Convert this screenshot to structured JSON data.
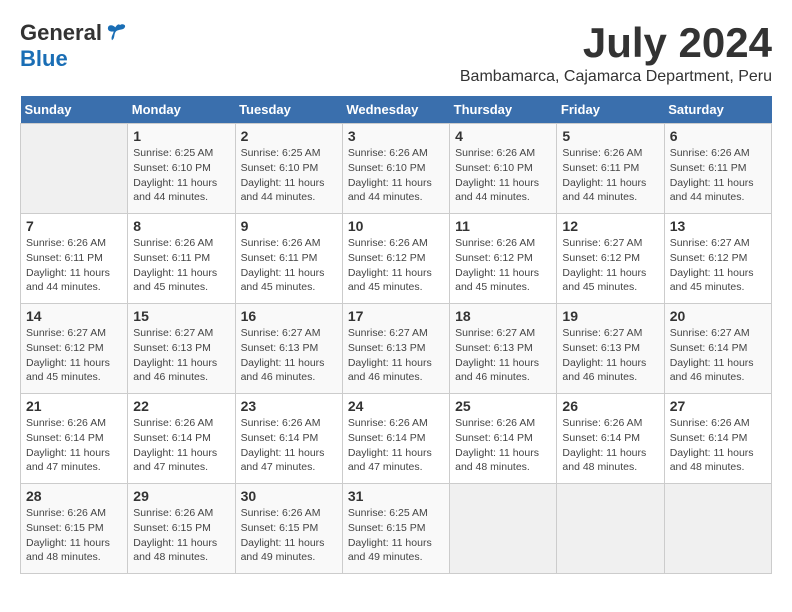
{
  "logo": {
    "general": "General",
    "blue": "Blue"
  },
  "title": {
    "month": "July 2024",
    "location": "Bambamarca, Cajamarca Department, Peru"
  },
  "calendar": {
    "headers": [
      "Sunday",
      "Monday",
      "Tuesday",
      "Wednesday",
      "Thursday",
      "Friday",
      "Saturday"
    ],
    "weeks": [
      [
        {
          "day": "",
          "info": ""
        },
        {
          "day": "1",
          "info": "Sunrise: 6:25 AM\nSunset: 6:10 PM\nDaylight: 11 hours\nand 44 minutes."
        },
        {
          "day": "2",
          "info": "Sunrise: 6:25 AM\nSunset: 6:10 PM\nDaylight: 11 hours\nand 44 minutes."
        },
        {
          "day": "3",
          "info": "Sunrise: 6:26 AM\nSunset: 6:10 PM\nDaylight: 11 hours\nand 44 minutes."
        },
        {
          "day": "4",
          "info": "Sunrise: 6:26 AM\nSunset: 6:10 PM\nDaylight: 11 hours\nand 44 minutes."
        },
        {
          "day": "5",
          "info": "Sunrise: 6:26 AM\nSunset: 6:11 PM\nDaylight: 11 hours\nand 44 minutes."
        },
        {
          "day": "6",
          "info": "Sunrise: 6:26 AM\nSunset: 6:11 PM\nDaylight: 11 hours\nand 44 minutes."
        }
      ],
      [
        {
          "day": "7",
          "info": "Sunrise: 6:26 AM\nSunset: 6:11 PM\nDaylight: 11 hours\nand 44 minutes."
        },
        {
          "day": "8",
          "info": "Sunrise: 6:26 AM\nSunset: 6:11 PM\nDaylight: 11 hours\nand 45 minutes."
        },
        {
          "day": "9",
          "info": "Sunrise: 6:26 AM\nSunset: 6:11 PM\nDaylight: 11 hours\nand 45 minutes."
        },
        {
          "day": "10",
          "info": "Sunrise: 6:26 AM\nSunset: 6:12 PM\nDaylight: 11 hours\nand 45 minutes."
        },
        {
          "day": "11",
          "info": "Sunrise: 6:26 AM\nSunset: 6:12 PM\nDaylight: 11 hours\nand 45 minutes."
        },
        {
          "day": "12",
          "info": "Sunrise: 6:27 AM\nSunset: 6:12 PM\nDaylight: 11 hours\nand 45 minutes."
        },
        {
          "day": "13",
          "info": "Sunrise: 6:27 AM\nSunset: 6:12 PM\nDaylight: 11 hours\nand 45 minutes."
        }
      ],
      [
        {
          "day": "14",
          "info": "Sunrise: 6:27 AM\nSunset: 6:12 PM\nDaylight: 11 hours\nand 45 minutes."
        },
        {
          "day": "15",
          "info": "Sunrise: 6:27 AM\nSunset: 6:13 PM\nDaylight: 11 hours\nand 46 minutes."
        },
        {
          "day": "16",
          "info": "Sunrise: 6:27 AM\nSunset: 6:13 PM\nDaylight: 11 hours\nand 46 minutes."
        },
        {
          "day": "17",
          "info": "Sunrise: 6:27 AM\nSunset: 6:13 PM\nDaylight: 11 hours\nand 46 minutes."
        },
        {
          "day": "18",
          "info": "Sunrise: 6:27 AM\nSunset: 6:13 PM\nDaylight: 11 hours\nand 46 minutes."
        },
        {
          "day": "19",
          "info": "Sunrise: 6:27 AM\nSunset: 6:13 PM\nDaylight: 11 hours\nand 46 minutes."
        },
        {
          "day": "20",
          "info": "Sunrise: 6:27 AM\nSunset: 6:14 PM\nDaylight: 11 hours\nand 46 minutes."
        }
      ],
      [
        {
          "day": "21",
          "info": "Sunrise: 6:26 AM\nSunset: 6:14 PM\nDaylight: 11 hours\nand 47 minutes."
        },
        {
          "day": "22",
          "info": "Sunrise: 6:26 AM\nSunset: 6:14 PM\nDaylight: 11 hours\nand 47 minutes."
        },
        {
          "day": "23",
          "info": "Sunrise: 6:26 AM\nSunset: 6:14 PM\nDaylight: 11 hours\nand 47 minutes."
        },
        {
          "day": "24",
          "info": "Sunrise: 6:26 AM\nSunset: 6:14 PM\nDaylight: 11 hours\nand 47 minutes."
        },
        {
          "day": "25",
          "info": "Sunrise: 6:26 AM\nSunset: 6:14 PM\nDaylight: 11 hours\nand 48 minutes."
        },
        {
          "day": "26",
          "info": "Sunrise: 6:26 AM\nSunset: 6:14 PM\nDaylight: 11 hours\nand 48 minutes."
        },
        {
          "day": "27",
          "info": "Sunrise: 6:26 AM\nSunset: 6:14 PM\nDaylight: 11 hours\nand 48 minutes."
        }
      ],
      [
        {
          "day": "28",
          "info": "Sunrise: 6:26 AM\nSunset: 6:15 PM\nDaylight: 11 hours\nand 48 minutes."
        },
        {
          "day": "29",
          "info": "Sunrise: 6:26 AM\nSunset: 6:15 PM\nDaylight: 11 hours\nand 48 minutes."
        },
        {
          "day": "30",
          "info": "Sunrise: 6:26 AM\nSunset: 6:15 PM\nDaylight: 11 hours\nand 49 minutes."
        },
        {
          "day": "31",
          "info": "Sunrise: 6:25 AM\nSunset: 6:15 PM\nDaylight: 11 hours\nand 49 minutes."
        },
        {
          "day": "",
          "info": ""
        },
        {
          "day": "",
          "info": ""
        },
        {
          "day": "",
          "info": ""
        }
      ]
    ]
  }
}
